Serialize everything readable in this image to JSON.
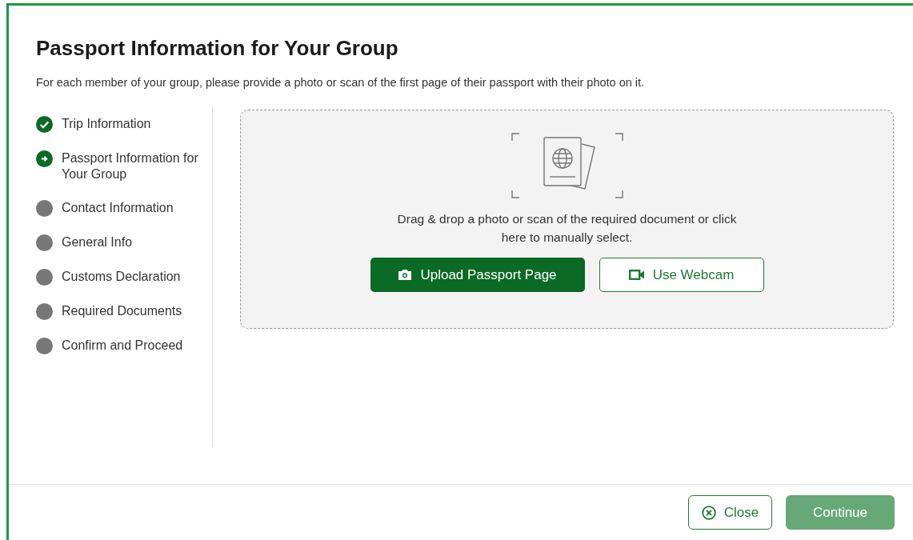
{
  "title": "Passport Information for Your Group",
  "description": "For each member of your group, please provide a photo or scan of the first page of their passport with their photo on it.",
  "steps": [
    {
      "label": "Trip Information",
      "kind": "done"
    },
    {
      "label": "Passport Information for Your Group",
      "kind": "current"
    },
    {
      "label": "Contact Information",
      "kind": "pending"
    },
    {
      "label": "General Info",
      "kind": "pending"
    },
    {
      "label": "Customs Declaration",
      "kind": "pending"
    },
    {
      "label": "Required Documents",
      "kind": "pending"
    },
    {
      "label": "Confirm and Proceed",
      "kind": "pending"
    }
  ],
  "upload": {
    "instructions": "Drag & drop a photo or scan of the required document or click here to manually select.",
    "buttons": [
      {
        "label": "Upload Passport Page",
        "kind": "primary"
      },
      {
        "label": "Use Webcam",
        "kind": "secondary"
      }
    ]
  },
  "footer": {
    "close": {
      "label": "Close"
    },
    "continue": {
      "label": "Continue",
      "disabled": true
    }
  }
}
